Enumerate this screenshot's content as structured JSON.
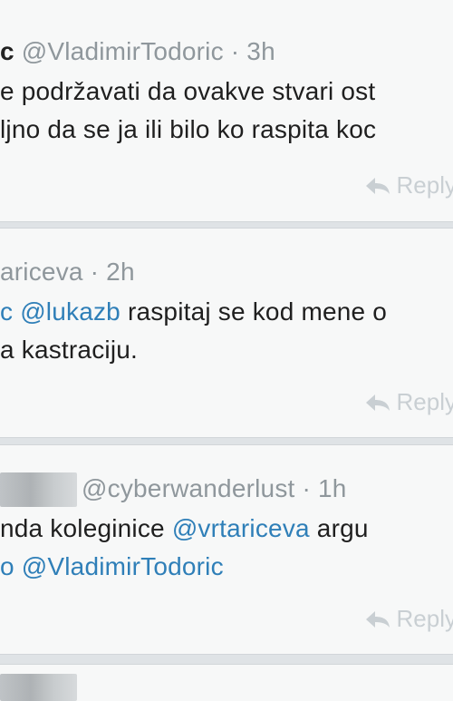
{
  "tweets": [
    {
      "name": "c",
      "handle": "@VladimirTodoric",
      "separator": "·",
      "time": "3h",
      "lines": [
        "e podržavati da ovakve stvari ost",
        "ljno da se ja ili bilo ko raspita koc"
      ],
      "reply": "Reply"
    },
    {
      "handle": "ariceva",
      "separator": "·",
      "time": "2h",
      "line1_mention_a": "c",
      "line1_mention_b": "@lukazb",
      "line1_text": "raspitaj se kod mene o",
      "line2_text": "a kastraciju.",
      "reply": "Reply"
    },
    {
      "handle": "@cyberwanderlust",
      "separator": "·",
      "time": "1h",
      "line1_text_a": "nda koleginice",
      "line1_mention": "@vrtariceva",
      "line1_text_b": "argu",
      "line2_text": "o",
      "line2_mention": "@VladimirTodoric",
      "reply": "Reply"
    }
  ]
}
